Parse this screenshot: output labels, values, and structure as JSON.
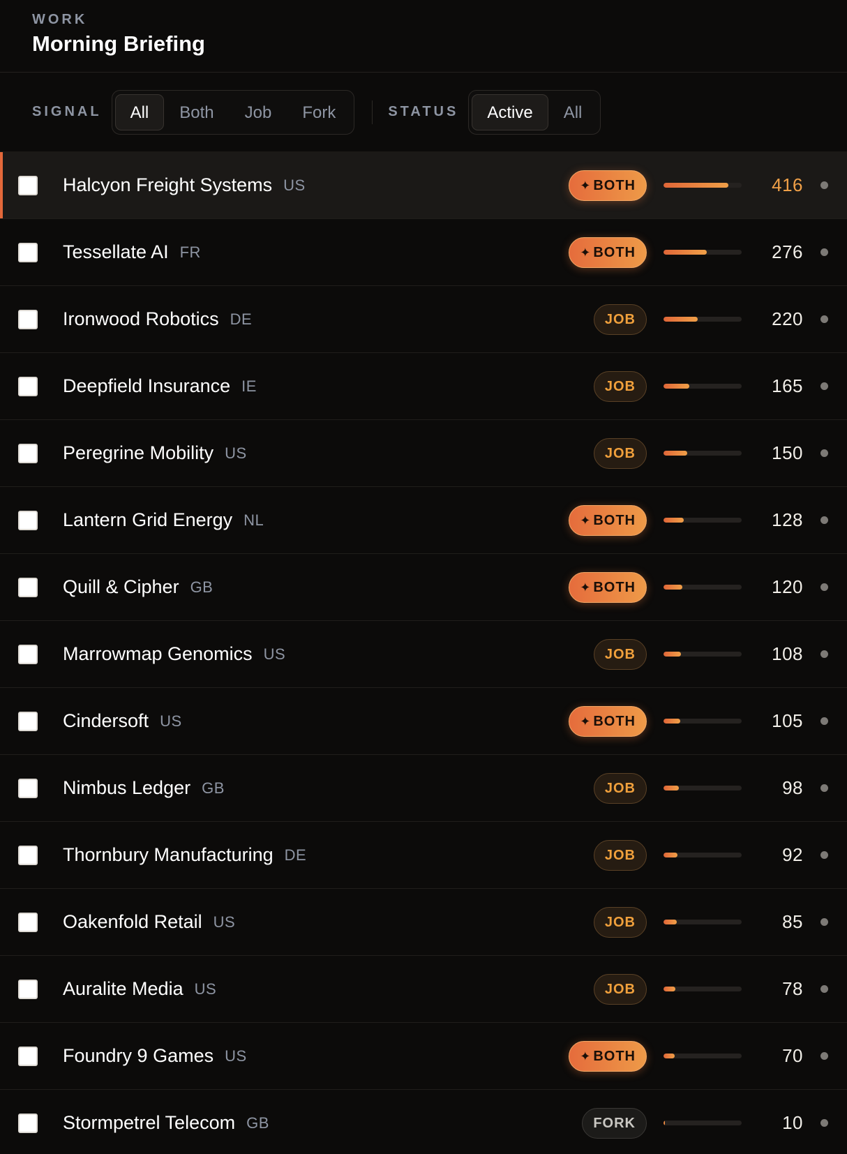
{
  "header": {
    "eyebrow": "WORK",
    "title": "Morning Briefing"
  },
  "filters": {
    "signal_label": "SIGNAL",
    "signal_options": [
      "All",
      "Both",
      "Job",
      "Fork"
    ],
    "signal_selected": "All",
    "status_label": "STATUS",
    "status_options": [
      "Active",
      "All"
    ],
    "status_selected": "Active"
  },
  "colors": {
    "accent": "#e3683a",
    "accent_light": "#f0a048",
    "background": "#0c0b0a"
  },
  "rows": [
    {
      "name": "Halcyon Freight Systems",
      "country": "US",
      "signal": "BOTH",
      "score": "416",
      "bar_fraction": 0.83,
      "selected": true
    },
    {
      "name": "Tessellate AI",
      "country": "FR",
      "signal": "BOTH",
      "score": "276",
      "bar_fraction": 0.55
    },
    {
      "name": "Ironwood Robotics",
      "country": "DE",
      "signal": "JOB",
      "score": "220",
      "bar_fraction": 0.44
    },
    {
      "name": "Deepfield Insurance",
      "country": "IE",
      "signal": "JOB",
      "score": "165",
      "bar_fraction": 0.33
    },
    {
      "name": "Peregrine Mobility",
      "country": "US",
      "signal": "JOB",
      "score": "150",
      "bar_fraction": 0.3
    },
    {
      "name": "Lantern Grid Energy",
      "country": "NL",
      "signal": "BOTH",
      "score": "128",
      "bar_fraction": 0.26
    },
    {
      "name": "Quill & Cipher",
      "country": "GB",
      "signal": "BOTH",
      "score": "120",
      "bar_fraction": 0.24
    },
    {
      "name": "Marrowmap Genomics",
      "country": "US",
      "signal": "JOB",
      "score": "108",
      "bar_fraction": 0.22
    },
    {
      "name": "Cindersoft",
      "country": "US",
      "signal": "BOTH",
      "score": "105",
      "bar_fraction": 0.21
    },
    {
      "name": "Nimbus Ledger",
      "country": "GB",
      "signal": "JOB",
      "score": "98",
      "bar_fraction": 0.2
    },
    {
      "name": "Thornbury Manufacturing",
      "country": "DE",
      "signal": "JOB",
      "score": "92",
      "bar_fraction": 0.18
    },
    {
      "name": "Oakenfold Retail",
      "country": "US",
      "signal": "JOB",
      "score": "85",
      "bar_fraction": 0.17
    },
    {
      "name": "Auralite Media",
      "country": "US",
      "signal": "JOB",
      "score": "78",
      "bar_fraction": 0.155
    },
    {
      "name": "Foundry 9 Games",
      "country": "US",
      "signal": "BOTH",
      "score": "70",
      "bar_fraction": 0.14
    },
    {
      "name": "Stormpetrel Telecom",
      "country": "GB",
      "signal": "FORK",
      "score": "10",
      "bar_fraction": 0.02
    }
  ]
}
